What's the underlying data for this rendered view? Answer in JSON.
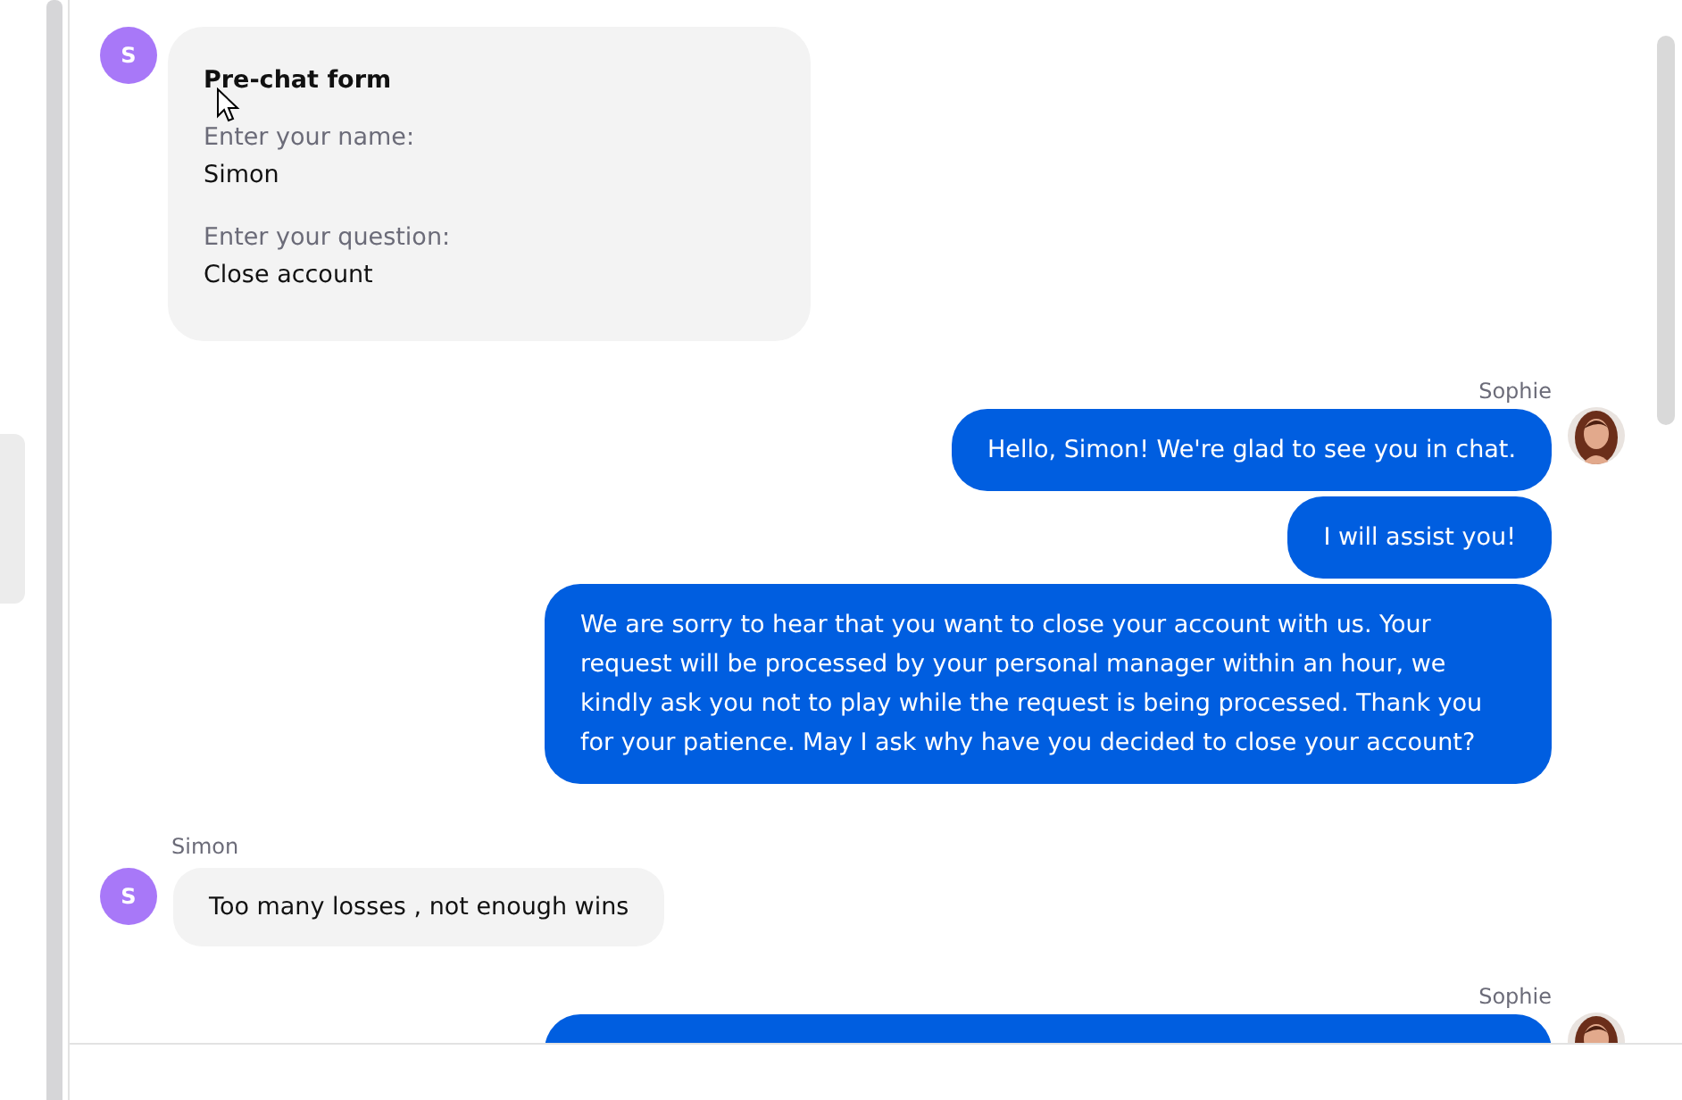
{
  "form_message": {
    "avatar_initial": "S",
    "title": "Pre-chat form",
    "fields": [
      {
        "label": "Enter your name:",
        "value": "Simon"
      },
      {
        "label": "Enter your question:",
        "value": "Close account"
      }
    ]
  },
  "messages": [
    {
      "kind": "agent",
      "sender": "Sophie",
      "bubbles": [
        "Hello, Simon! We're glad to see you in chat.",
        "I will assist you!",
        "We are sorry to hear that you want to close your account with us. Your request will be processed by your personal manager within an hour, we kindly ask you not to play while the request is being processed. Thank you for your patience. May I ask why have you decided to close your account?"
      ]
    },
    {
      "kind": "visitor",
      "sender": "Simon",
      "avatar_initial": "S",
      "bubbles": [
        "Too many losses , not enough wins"
      ]
    },
    {
      "kind": "agent",
      "sender": "Sophie",
      "partial_bubble": true
    }
  ]
}
